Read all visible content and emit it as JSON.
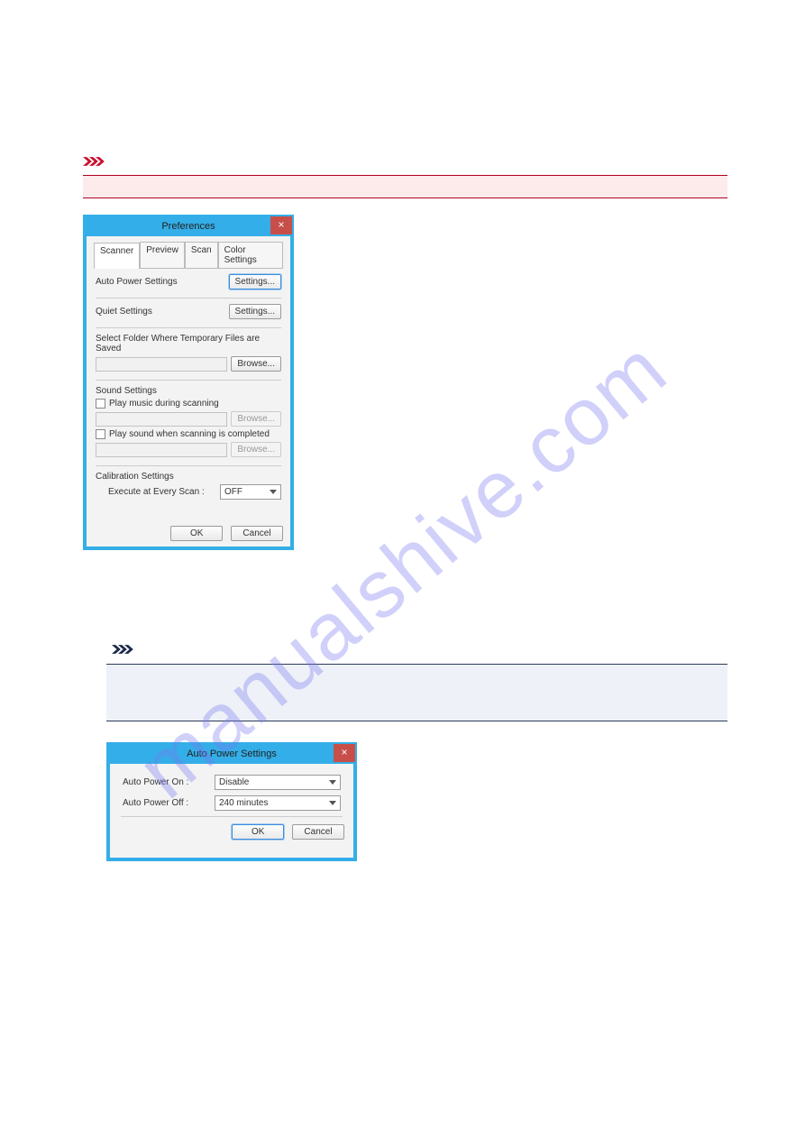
{
  "watermark": "manualshive.com",
  "pref_dialog": {
    "title": "Preferences",
    "tabs": [
      "Scanner",
      "Preview",
      "Scan",
      "Color Settings"
    ],
    "auto_power_label": "Auto Power Settings",
    "settings_btn": "Settings...",
    "quiet_label": "Quiet Settings",
    "folder_label": "Select Folder Where Temporary Files are Saved",
    "browse_btn": "Browse...",
    "sound_label": "Sound Settings",
    "play_music_label": "Play music during scanning",
    "play_sound_label": "Play sound when scanning is completed",
    "calibration_label": "Calibration Settings",
    "execute_label": "Execute at Every Scan :",
    "execute_value": "OFF",
    "ok_btn": "OK",
    "cancel_btn": "Cancel"
  },
  "auto_dialog": {
    "title": "Auto Power Settings",
    "on_label": "Auto Power On :",
    "on_value": "Disable",
    "off_label": "Auto Power Off :",
    "off_value": "240 minutes",
    "ok_btn": "OK",
    "cancel_btn": "Cancel"
  }
}
